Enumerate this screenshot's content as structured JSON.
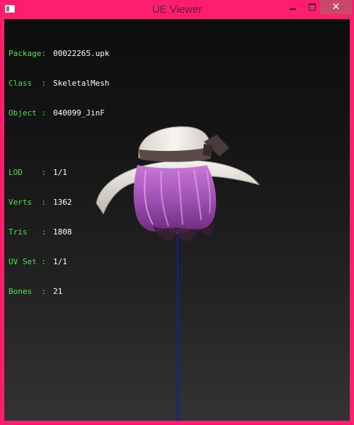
{
  "window": {
    "title": "UE Viewer",
    "icon": "app-icon",
    "controls": {
      "minimize": "minimize-icon",
      "maximize": "maximize-icon",
      "close": "close-icon"
    },
    "colors": {
      "frame": "#ff1e6e",
      "close_button": "#c74b68",
      "label": "#4fe04f",
      "value": "#ffffff",
      "axis": "#1a1aa8"
    }
  },
  "info": {
    "package": {
      "label": "Package:",
      "value": "00022265.upk"
    },
    "class": {
      "label": "Class  :",
      "value": "SkeletalMesh"
    },
    "object": {
      "label": "Object :",
      "value": "040099_JinF"
    },
    "lod": {
      "label": "LOD    :",
      "value": "1/1"
    },
    "verts": {
      "label": "Verts  :",
      "value": "1362"
    },
    "tris": {
      "label": "Tris   :",
      "value": "1808"
    },
    "uvset": {
      "label": "UV Set :",
      "value": "1/1"
    },
    "bones": {
      "label": "Bones  :",
      "value": "21"
    }
  }
}
